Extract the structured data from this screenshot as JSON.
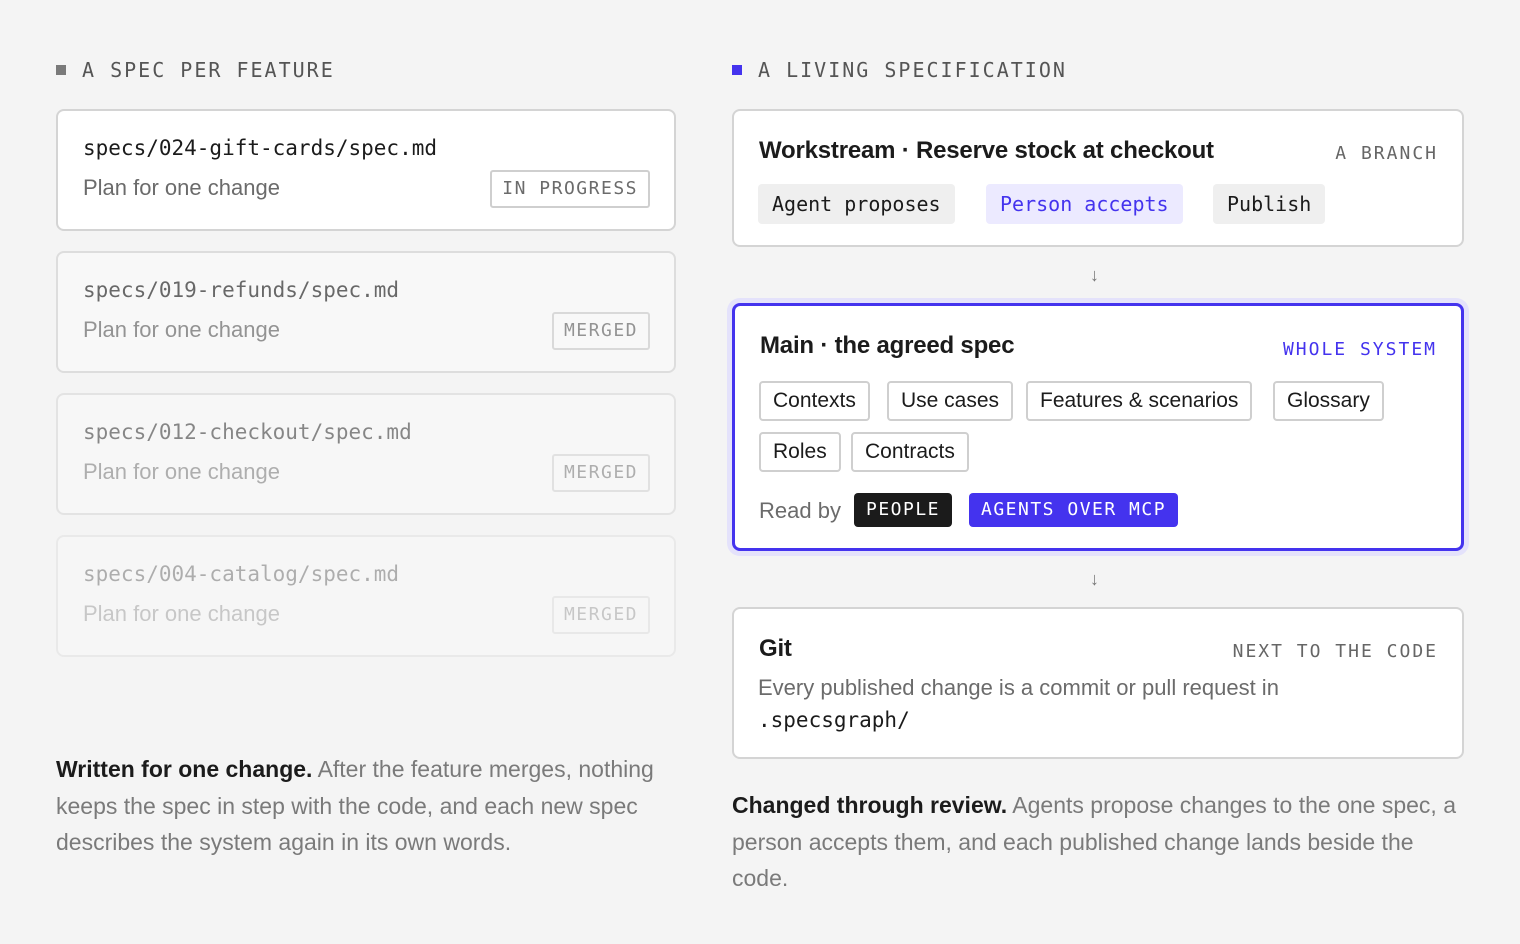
{
  "left": {
    "label": "A SPEC PER FEATURE",
    "specs": [
      {
        "path": "specs/024-gift-cards/spec.md",
        "subtitle": "Plan for one change",
        "status": "IN PROGRESS"
      },
      {
        "path": "specs/019-refunds/spec.md",
        "subtitle": "Plan for one change",
        "status": "MERGED"
      },
      {
        "path": "specs/012-checkout/spec.md",
        "subtitle": "Plan for one change",
        "status": "MERGED"
      },
      {
        "path": "specs/004-catalog/spec.md",
        "subtitle": "Plan for one change",
        "status": "MERGED"
      }
    ],
    "caption_bold": "Written for one change.",
    "caption_text": "After the feature merges, nothing keeps the spec in step with the code, and each new spec describes the system again in its own words."
  },
  "right": {
    "label": "A LIVING SPECIFICATION",
    "workstream": {
      "title": "Workstream · Reserve stock at checkout",
      "tag": "A BRANCH",
      "steps": [
        "Agent proposes",
        "Person accepts",
        "Publish"
      ]
    },
    "arrow": "↓",
    "main": {
      "title": "Main · the agreed spec",
      "tag": "WHOLE SYSTEM",
      "items": [
        "Contexts",
        "Use cases",
        "Features & scenarios",
        "Glossary",
        "Roles",
        "Contracts"
      ],
      "read_by": "Read by",
      "readers": [
        "PEOPLE",
        "AGENTS OVER MCP"
      ]
    },
    "git": {
      "title": "Git",
      "tag": "NEXT TO THE CODE",
      "text": "Every published change is a commit or pull request in",
      "path": ".specsgraph/"
    },
    "caption_bold": "Changed through review.",
    "caption_text": "Agents propose changes to the one spec, a person accepts them, and each published change lands beside the code."
  },
  "colors": {
    "accent": "#4433ee",
    "accent_soft": "#eceaff",
    "dark_pill": "#1b1b1b",
    "border": "#d4d4d4"
  }
}
